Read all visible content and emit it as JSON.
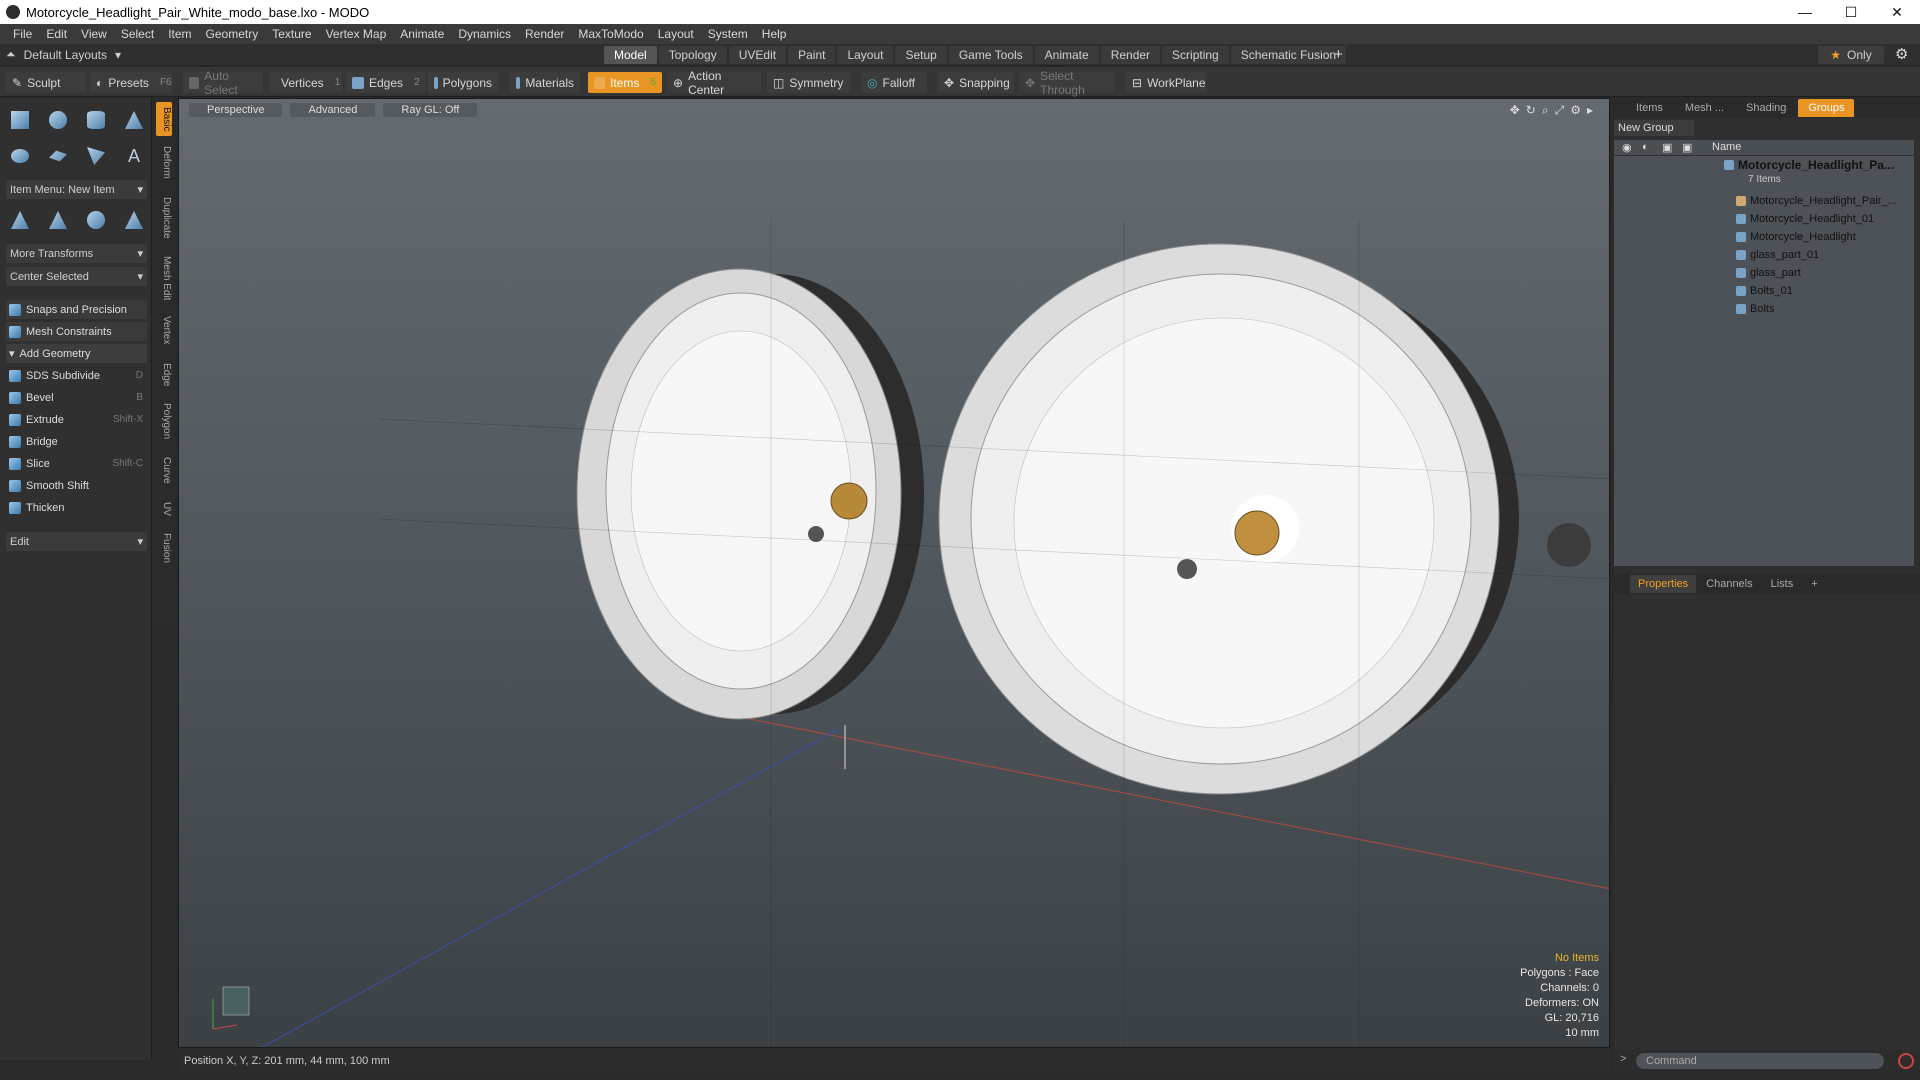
{
  "window": {
    "title": "Motorcycle_Headlight_Pair_White_modo_base.lxo - MODO"
  },
  "menu": [
    "File",
    "Edit",
    "View",
    "Select",
    "Item",
    "Geometry",
    "Texture",
    "Vertex Map",
    "Animate",
    "Dynamics",
    "Render",
    "MaxToModo",
    "Layout",
    "System",
    "Help"
  ],
  "layout": {
    "name": "Default Layouts",
    "tabs": [
      "Model",
      "Topology",
      "UVEdit",
      "Paint",
      "Layout",
      "Setup",
      "Game Tools",
      "Animate",
      "Render",
      "Scripting",
      "Schematic Fusion"
    ],
    "active": "Model",
    "only": "Only"
  },
  "toolbar": {
    "sculpt": "Sculpt",
    "presets": "Presets",
    "presets_key": "F6",
    "auto_select": "Auto Select",
    "vertices": "Vertices",
    "vertices_n": "1",
    "edges": "Edges",
    "edges_n": "2",
    "polygons": "Polygons",
    "materials": "Materials",
    "items": "Items",
    "items_n": "5",
    "action_center": "Action Center",
    "symmetry": "Symmetry",
    "falloff": "Falloff",
    "snapping": "Snapping",
    "select_through": "Select Through",
    "workplane": "WorkPlane"
  },
  "left": {
    "item_menu": "Item Menu: New Item",
    "more_transforms": "More Transforms",
    "center_selected": "Center Selected",
    "snaps": "Snaps and Precision",
    "constraints": "Mesh Constraints",
    "add_geometry": "Add Geometry",
    "tools": [
      {
        "label": "SDS Subdivide",
        "key": "D"
      },
      {
        "label": "Bevel",
        "key": "B"
      },
      {
        "label": "Extrude",
        "key": "Shift-X"
      },
      {
        "label": "Bridge",
        "key": ""
      },
      {
        "label": "Slice",
        "key": "Shift-C"
      },
      {
        "label": "Smooth Shift",
        "key": ""
      },
      {
        "label": "Thicken",
        "key": ""
      }
    ],
    "edit": "Edit",
    "vtabs": [
      "Basic",
      "Deform",
      "Duplicate",
      "Mesh Edit",
      "Vertex",
      "Edge",
      "Polygon",
      "Curve",
      "UV",
      "Fusion"
    ]
  },
  "viewport": {
    "perspective": "Perspective",
    "advanced": "Advanced",
    "raygl": "Ray GL: Off",
    "stats": {
      "items": "No Items",
      "polygons": "Polygons : Face",
      "channels": "Channels: 0",
      "deformers": "Deformers: ON",
      "gl": "GL: 20,716",
      "size": "10 mm"
    }
  },
  "right": {
    "tabs": [
      "Items",
      "Mesh ...",
      "Shading",
      "Groups"
    ],
    "active": "Groups",
    "new_group": "New Group",
    "col_name": "Name",
    "root": "Motorcycle_Headlight_Pa...",
    "root_sub": "7 Items",
    "children": [
      "Motorcycle_Headlight_Pair_...",
      "Motorcycle_Headlight_01",
      "Motorcycle_Headlight",
      "glass_part_01",
      "glass_part",
      "Bolts_01",
      "Bolts"
    ],
    "ptabs": [
      "Properties",
      "Channels",
      "Lists"
    ]
  },
  "status": {
    "position": "Position X, Y, Z:  201 mm, 44 mm, 100 mm"
  },
  "command": {
    "placeholder": "Command"
  }
}
